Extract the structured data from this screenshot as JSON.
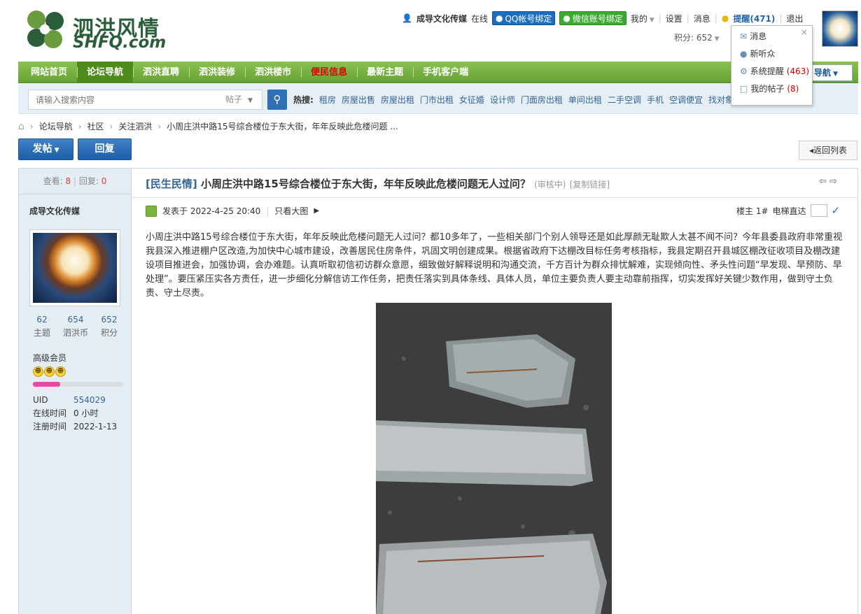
{
  "logo": {
    "cn": "泗洪风情",
    "en": "SHFQ.com"
  },
  "topbar": {
    "username": "成导文化传媒",
    "status": "在线",
    "qq_bind": "QQ帐号绑定",
    "wx_bind": "微信账号绑定",
    "mine": "我的",
    "settings": "设置",
    "messages": "消息",
    "remind": "提醒(471)",
    "logout": "退出",
    "points": "积分: 652"
  },
  "popup": {
    "items": [
      {
        "label": "消息",
        "count": ""
      },
      {
        "label": "新听众",
        "count": ""
      },
      {
        "label": "系统提醒",
        "count": "(463)"
      },
      {
        "label": "我的帖子",
        "count": "(8)"
      }
    ],
    "close": "×"
  },
  "nav": {
    "items": [
      "网站首页",
      "论坛导航",
      "泗洪直聘",
      "泗洪装修",
      "泗洪楼市",
      "便民信息",
      "最新主题",
      "手机客户端"
    ],
    "right": "导航"
  },
  "search": {
    "placeholder": "请输入搜索内容",
    "type": "帖子",
    "hot_label": "热搜:",
    "hot": [
      "租房",
      "房屋出售",
      "房屋出租",
      "门市出租",
      "女征婚",
      "设计师",
      "门面房出租",
      "单间出租",
      "二手空调",
      "手机",
      "空调便宜",
      "找对象"
    ]
  },
  "breadcrumb": [
    "论坛导航",
    "社区",
    "关注泗洪",
    "小周庄洪中路15号综合楼位于东大街，年年反映此危楼问题 ..."
  ],
  "actions": {
    "post": "发帖",
    "reply": "回复",
    "back": "返回列表"
  },
  "thread": {
    "views_label": "查看:",
    "views": "8",
    "replies_label": "回复:",
    "replies": "0",
    "category": "[民生民情]",
    "title": "小周庄洪中路15号综合楼位于东大街，年年反映此危楼问题无人过问？",
    "review": "(审核中)",
    "copy_link": "[复制链接]"
  },
  "author": {
    "name": "成导文化传媒",
    "stats": [
      {
        "num": "62",
        "label": "主题"
      },
      {
        "num": "654",
        "label": "泗洪币"
      },
      {
        "num": "652",
        "label": "积分"
      }
    ],
    "level": "高级会员",
    "level_progress": 0.3,
    "uid_label": "UID",
    "uid": "554029",
    "online_label": "在线时间",
    "online": "0 小时",
    "reg_label": "注册时间",
    "reg": "2022-1-13"
  },
  "post": {
    "posted_on": "发表于 2022-4-25 20:40",
    "only_pic": "只看大图",
    "floor": "楼主 1#",
    "elevator": "电梯直达",
    "body": "小周庄洪中路15号综合楼位于东大街，年年反映此危楼问题无人过问？都10多年了，一些相关部门个别人领导还是如此厚颜无耻欺人太甚不闻不问？今年县委县政府非常重视我县深入推进棚户区改造,为加快中心城市建设，改善居民住房条件，巩固文明创建成果。根据省政府下达棚改目标任务考核指标，我县定期召开县城区棚改征收项目及棚改建设项目推进会，加强协调，会办难题。认真听取初信初访群众意愿，细致做好解释说明和沟通交流，千方百计为群众排忧解难，实现倾向性、矛头性问题“早发现、早预防、早处理”。要压紧压实各方责任，进一步细化分解信访工作任务，把责任落实到具体条线、具体人员，单位主要负责人要主动靠前指挥，切实发挥好关键少数作用，做到守土负责、守土尽责。"
  }
}
